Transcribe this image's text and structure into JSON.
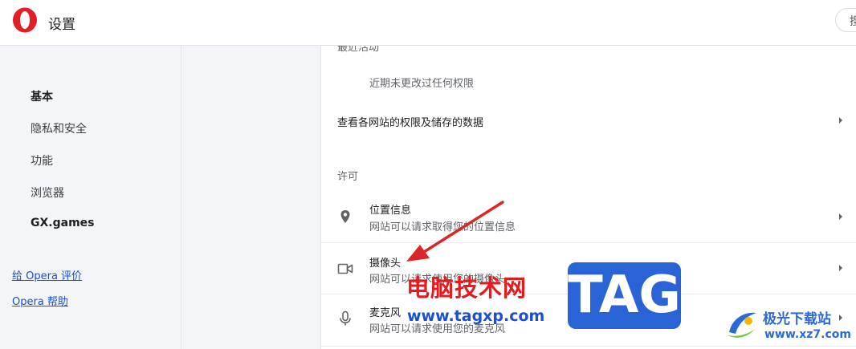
{
  "header": {
    "title": "设置",
    "search_label": "搜"
  },
  "sidebar": {
    "items": [
      {
        "label": "基本",
        "active": true
      },
      {
        "label": "隐私和安全",
        "active": false
      },
      {
        "label": "功能",
        "active": false
      },
      {
        "label": "浏览器",
        "active": false
      },
      {
        "label": "GX.games",
        "active": false
      }
    ],
    "links": [
      {
        "label": "给 Opera 评价"
      },
      {
        "label": "Opera 帮助"
      }
    ]
  },
  "main": {
    "cut_header": "最近活动",
    "recent_note": "近期未更改过任何权限",
    "all_sites_row": "查看各网站的权限及储存的数据",
    "permissions_title": "许可",
    "permissions": [
      {
        "title": "位置信息",
        "desc": "网站可以请求取得您的位置信息",
        "icon": "location-pin-icon"
      },
      {
        "title": "摄像头",
        "desc": "网站可以请求使用您的摄像头",
        "icon": "camera-icon"
      },
      {
        "title": "麦克风",
        "desc": "网站可以请求使用您的麦克风",
        "icon": "microphone-icon"
      }
    ]
  },
  "watermark": {
    "cn_text": "电脑技术网",
    "url": "www.tagxp.com",
    "tag": "TAG",
    "site_name": "极光下载站",
    "site_url": "www.xz7.com"
  },
  "colors": {
    "opera_red": "#e01f26",
    "sidebar_bg": "#f3f5f8",
    "link_blue": "#1a4ecb",
    "arrow_red": "#d9262b"
  }
}
